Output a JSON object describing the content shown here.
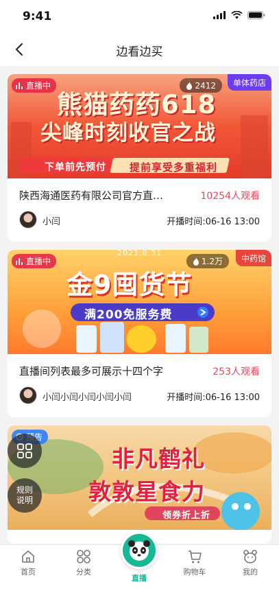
{
  "status_bar": {
    "time": "9:41"
  },
  "nav": {
    "title": "边看边买"
  },
  "cards": [
    {
      "live_tag": "直播中",
      "views": "2412",
      "store_tag": "单体药店",
      "banner_line1": "熊猫药药618",
      "banner_line2": "尖峰时刻收官之战",
      "banner_sub1": "下单前先预付",
      "banner_sub2": "提前享受多重福利",
      "title": "陕西海通医药有限公司官方直…",
      "viewers": "10254人观看",
      "host": "小闫",
      "start_time": "开播时间:06-16 13:00"
    },
    {
      "live_tag": "直播中",
      "views": "1.2万",
      "store_tag": "中药馆",
      "banner_line1": "金9囤货节",
      "banner_sub1": "满200免服务费",
      "banner_date": "2021.8.31",
      "title": "直播间列表最多可展示十四个字",
      "viewers": "253人观看",
      "host": "小闫小闫小闫小闫小闫",
      "start_time": "开播时间:06-16 13:00"
    },
    {
      "live_tag": "预告",
      "banner_line1": "非凡鹤礼",
      "banner_line2": "敦敦星食力",
      "banner_sub1": "领券折上折"
    }
  ],
  "float_buttons": {
    "rules_label_1": "规则",
    "rules_label_2": "说明"
  },
  "tabs": [
    {
      "label": "首页",
      "icon": "home-icon"
    },
    {
      "label": "分类",
      "icon": "category-icon"
    },
    {
      "label": "直播",
      "icon": "panda-live-icon"
    },
    {
      "label": "购物车",
      "icon": "cart-icon"
    },
    {
      "label": "我的",
      "icon": "profile-icon"
    }
  ],
  "colors": {
    "accent": "#17b894",
    "viewer_red": "#e8455a",
    "store_purple": "#6a3df0"
  }
}
